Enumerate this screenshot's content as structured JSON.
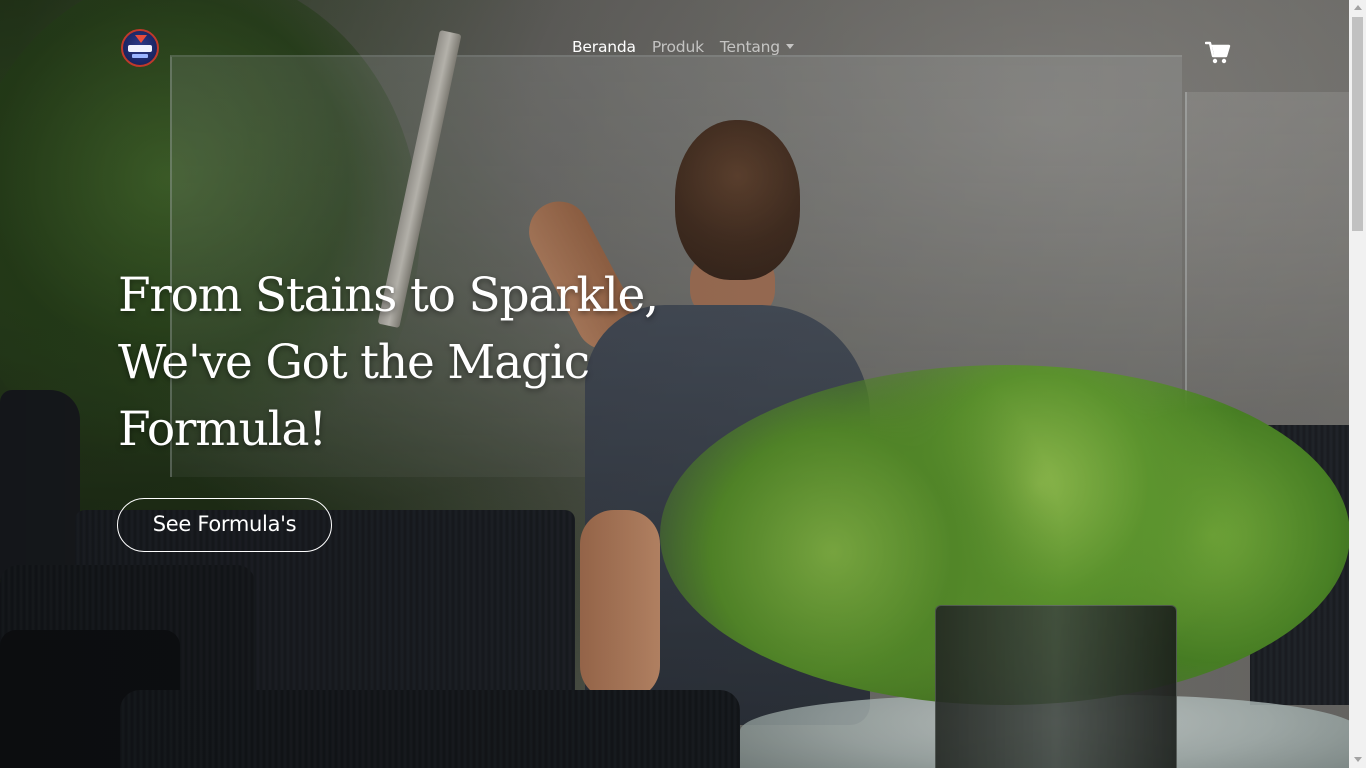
{
  "navbar": {
    "brand": {
      "icon": "brand-logo"
    },
    "links": [
      {
        "label": "Beranda",
        "active": true
      },
      {
        "label": "Produk",
        "active": false
      },
      {
        "label": "Tentang",
        "active": false,
        "dropdown": true
      }
    ],
    "cart": {
      "icon": "shopping-cart-icon"
    }
  },
  "hero": {
    "title_line_1": "From Stains to Sparkle,",
    "title_line_2": "We've Got the Magic",
    "title_line_3": "Formula!",
    "button_label": "See Formula's"
  },
  "colors": {
    "text": "#ffffff",
    "nav_inactive": "rgba(255,255,255,0.62)"
  }
}
